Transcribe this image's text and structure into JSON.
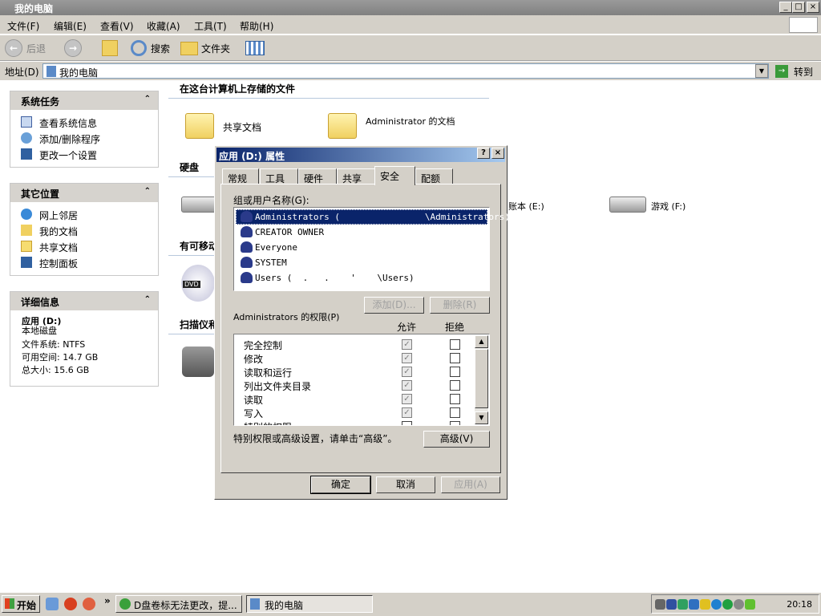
{
  "window": {
    "title": "我的电脑",
    "min": "_",
    "max": "□",
    "close": "×"
  },
  "menu": [
    "文件(F)",
    "编辑(E)",
    "查看(V)",
    "收藏(A)",
    "工具(T)",
    "帮助(H)"
  ],
  "toolbar": {
    "back": "后退",
    "search": "搜索",
    "folders": "文件夹"
  },
  "address": {
    "label": "地址(D)",
    "value": "我的电脑",
    "go": "转到"
  },
  "panels": [
    {
      "title": "系统任务",
      "items": [
        "查看系统信息",
        "添加/删除程序",
        "更改一个设置"
      ]
    },
    {
      "title": "其它位置",
      "items": [
        "网上邻居",
        "我的文档",
        "共享文档",
        "控制面板"
      ]
    },
    {
      "title": "详细信息",
      "name": "应用 (D:)",
      "type": "本地磁盘",
      "fs": "文件系统: NTFS",
      "free": "可用空间: 14.7 GB",
      "total": "总大小: 15.6 GB"
    }
  ],
  "content": {
    "sections": [
      "在这台计算机上存储的文件",
      "硬盘",
      "有可移动存储的设备",
      "扫描仪和照相机"
    ],
    "files": [
      "共享文档",
      "Administrator 的文档"
    ],
    "drives": [
      "账本 (E:)",
      "游戏 (F:)"
    ],
    "dvd_label": "DVD"
  },
  "dialog": {
    "title": "应用 (D:) 属性",
    "help": "?",
    "close": "×",
    "tabs": [
      "常规",
      "工具",
      "硬件",
      "共享",
      "安全",
      "配额"
    ],
    "active_tab": "安全",
    "group_label": "组或用户名称(G):",
    "users": [
      "Administrators (                \\Administrators)",
      "CREATOR OWNER",
      "Everyone",
      "SYSTEM",
      "Users (  .   .    '    \\Users)"
    ],
    "add": "添加(D)...",
    "remove": "删除(R)",
    "perm_label": "Administrators 的权限(P)",
    "allow": "允许",
    "deny": "拒绝",
    "perms": [
      {
        "name": "完全控制",
        "allow": true,
        "deny": false
      },
      {
        "name": "修改",
        "allow": true,
        "deny": false
      },
      {
        "name": "读取和运行",
        "allow": true,
        "deny": false
      },
      {
        "name": "列出文件夹目录",
        "allow": true,
        "deny": false
      },
      {
        "name": "读取",
        "allow": true,
        "deny": false
      },
      {
        "name": "写入",
        "allow": true,
        "deny": false
      },
      {
        "name": "特别的权限",
        "allow": false,
        "deny": false
      }
    ],
    "advanced_hint": "特别权限或高级设置，请单击“高级”。",
    "advanced": "高级(V)",
    "ok": "确定",
    "cancel": "取消",
    "apply": "应用(A)"
  },
  "taskbar": {
    "start": "开始",
    "chevron": "»",
    "tasks": [
      "D盘卷标无法更改，提...",
      "我的电脑"
    ],
    "clock": "20:18"
  }
}
